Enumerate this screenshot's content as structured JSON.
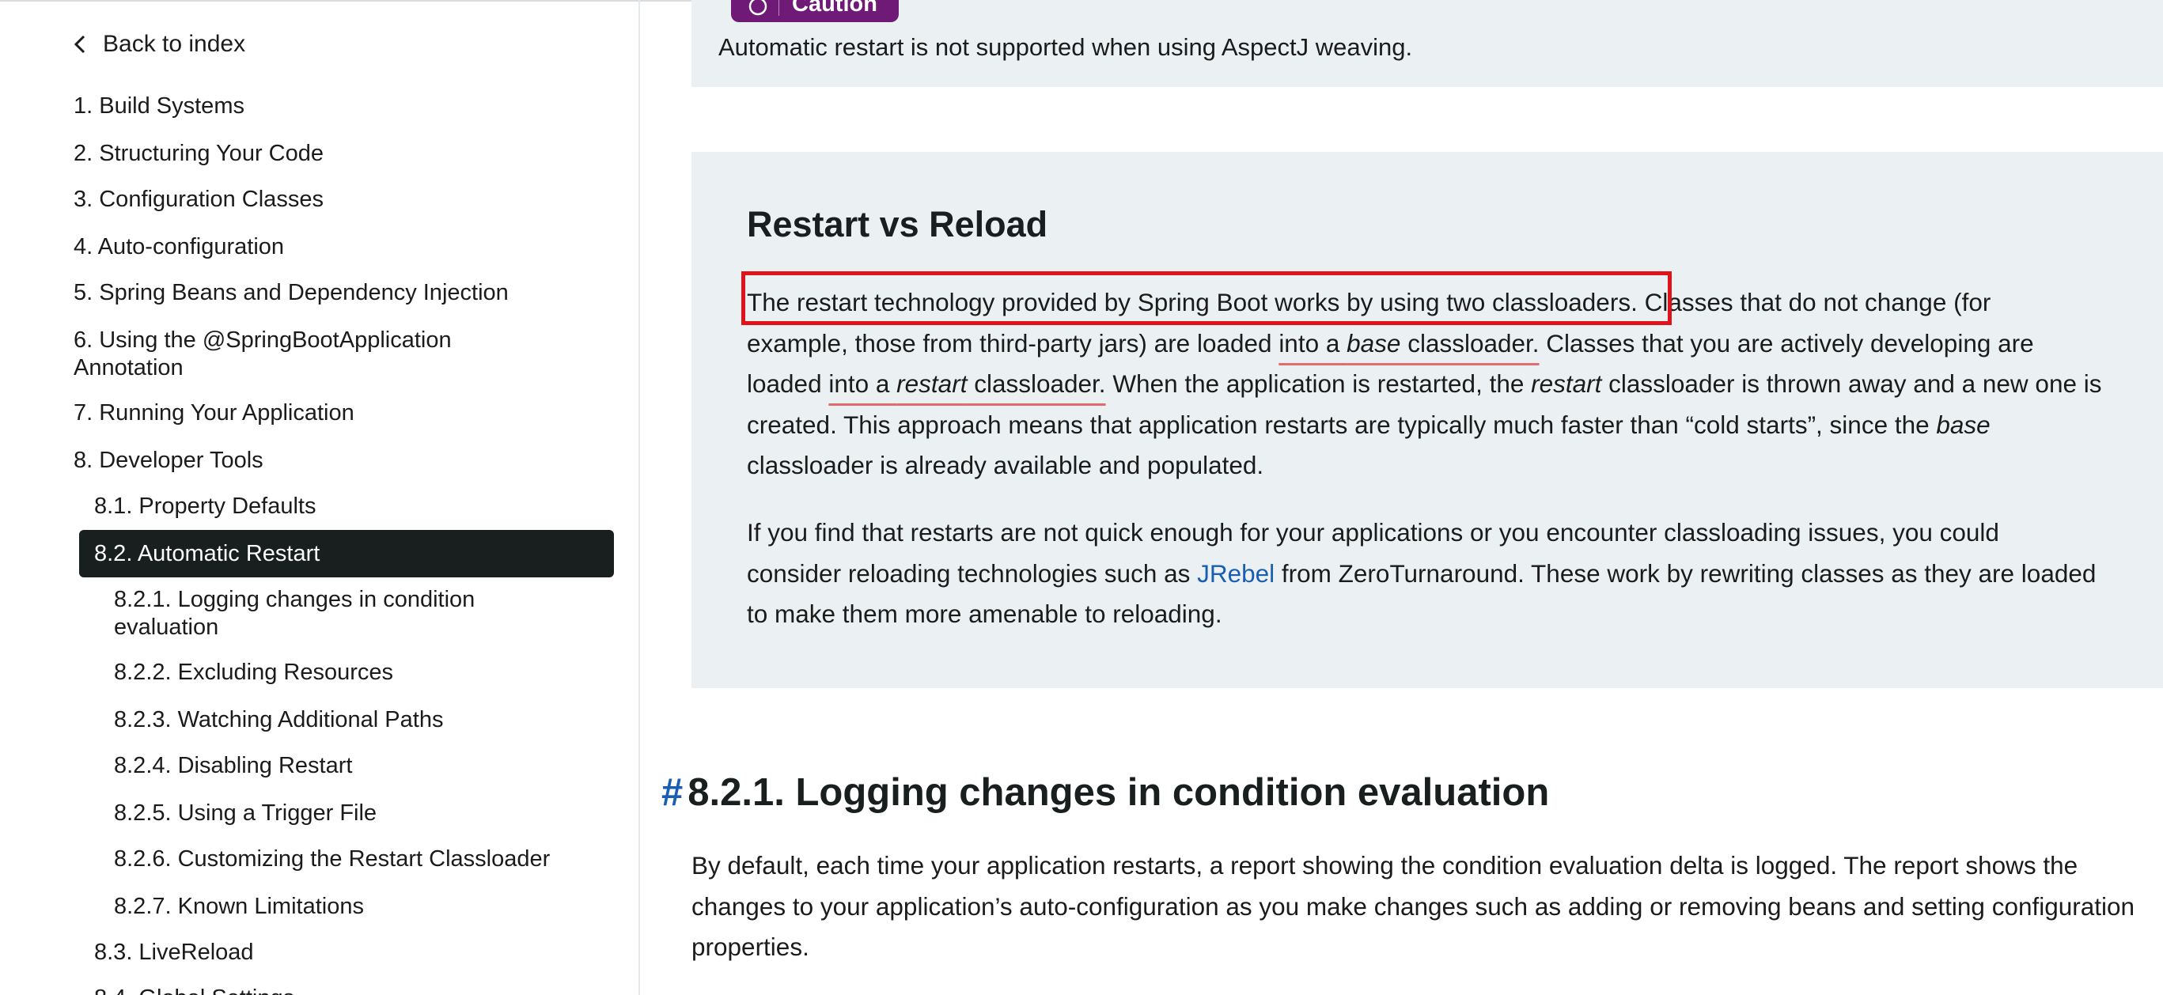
{
  "sidebar": {
    "back_label": "Back to index",
    "items": [
      {
        "label": "1. Build Systems"
      },
      {
        "label": "2. Structuring Your Code"
      },
      {
        "label": "3. Configuration Classes"
      },
      {
        "label": "4. Auto-configuration"
      },
      {
        "label": "5. Spring Beans and Dependency Injection"
      },
      {
        "label": "6. Using the @SpringBootApplication",
        "label2": "Annotation"
      },
      {
        "label": "7. Running Your Application"
      },
      {
        "label": "8. Developer Tools"
      },
      {
        "label": "8.1. Property Defaults"
      },
      {
        "label": "8.2. Automatic Restart"
      },
      {
        "label": "8.2.1. Logging changes in condition",
        "label2": "evaluation"
      },
      {
        "label": "8.2.2. Excluding Resources"
      },
      {
        "label": "8.2.3. Watching Additional Paths"
      },
      {
        "label": "8.2.4. Disabling Restart"
      },
      {
        "label": "8.2.5. Using a Trigger File"
      },
      {
        "label": "8.2.6. Customizing the Restart Classloader"
      },
      {
        "label": "8.2.7. Known Limitations"
      },
      {
        "label": "8.3. LiveReload"
      },
      {
        "label": "8.4. Global Settings"
      }
    ]
  },
  "caution": {
    "badge": "Caution",
    "text": "Automatic restart is not supported when using AspectJ weaving."
  },
  "panel": {
    "title": "Restart vs Reload",
    "p1": {
      "highlight": "The restart technology provided by Spring Boot works by using two classloaders.",
      "line1_rest": " Classes that do not change (for",
      "line2_a": "example, those from third-party jars) are loaded ",
      "line2_u1": "into a ",
      "line2_u_em": "base",
      "line2_u2": " classloader.",
      "line2_b": " Classes that you are actively developing are",
      "line3_a": "loaded ",
      "line3_u1": "into a ",
      "line3_u_em": "restart",
      "line3_u2": " classloader.",
      "line3_b": " When the application is restarted, the ",
      "line3_em": "restart",
      "line3_c": " classloader is thrown away and a new one is",
      "line4_a": "created. This approach means that application restarts are typically much faster than “cold starts”, since the ",
      "line4_em": "base",
      "line5": "classloader is already available and populated."
    },
    "p2": {
      "line1": "If you find that restarts are not quick enough for your applications or you encounter classloading issues, you could",
      "line2_a": "consider reloading technologies such as ",
      "line2_link": "JRebel",
      "line2_b": " from ZeroTurnaround. These work by rewriting classes as they are loaded",
      "line3": "to make them more amenable to reloading."
    }
  },
  "section": {
    "hash": "#",
    "title": "8.2.1. Logging changes in condition evaluation",
    "line1": "By default, each time your application restarts, a report showing the condition evaluation delta is logged. The report shows the",
    "line2": "changes to your application’s auto-configuration as you make changes such as adding or removing beans and setting configuration",
    "line3": "properties."
  }
}
